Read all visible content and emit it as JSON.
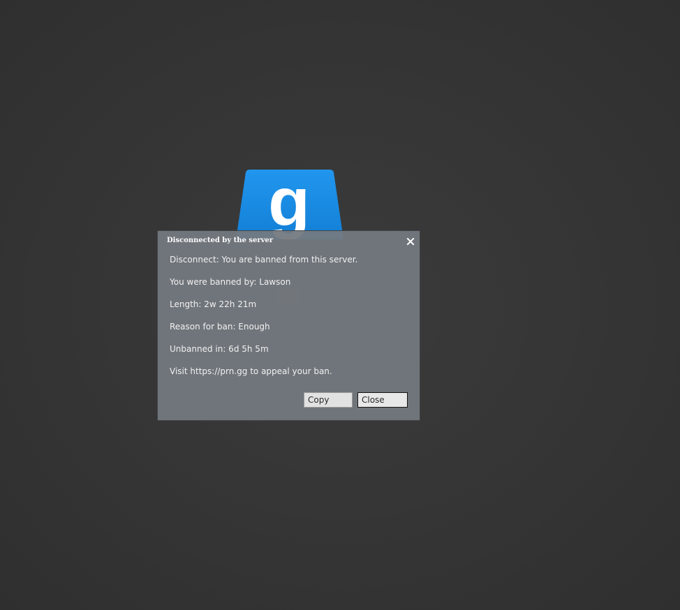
{
  "dialog": {
    "title": "Disconnected by the server",
    "close_icon": "close-icon",
    "lines": [
      "Disconnect: You are banned from this server.",
      "You were banned by: Lawson",
      "Length: 2w 22h 21m",
      "Reason for ban: Enough",
      "Unbanned in: 6d 5h 5m",
      "Visit https://prn.gg to appeal your ban."
    ],
    "buttons": {
      "copy_label": "Copy",
      "close_label": "Close"
    }
  },
  "logo": {
    "icon": "gmod-logo-icon",
    "letter": "g",
    "color": "#1a8fe3"
  },
  "colors": {
    "background": "#363636",
    "dialog_bg": "#74797f",
    "logo_blue": "#1a8fe3"
  }
}
